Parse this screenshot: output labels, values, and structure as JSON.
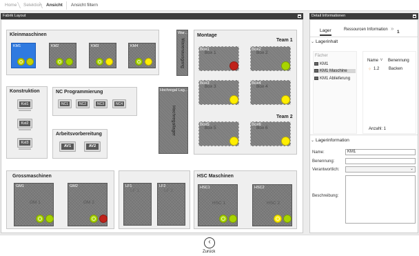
{
  "breadcrumb": {
    "home": "Home",
    "selection": "Selektion",
    "current": "Ansicht",
    "filter": "Ansicht filtern"
  },
  "layout_panel": {
    "title": "Fabrik Layout"
  },
  "kleinmaschinen": {
    "title": "Kleinmaschinen",
    "machines": [
      {
        "label": "KM1",
        "selected": true,
        "dots": [
          "#c8d400",
          "#c8d400"
        ]
      },
      {
        "label": "KM2",
        "dots": [
          "#a8d400",
          "#a8d400"
        ]
      },
      {
        "label": "KM3",
        "dots": [
          "#a8d400",
          "#ffee00"
        ]
      },
      {
        "label": "KM4",
        "dots": [
          "#a8d400",
          "#ffee00"
        ]
      }
    ]
  },
  "warenausgang": {
    "title": "War...",
    "text": "Warenausgang"
  },
  "hochregal": {
    "title": "Hochregal Lag...",
    "text": "Hochregallager"
  },
  "konstruktion": {
    "title": "Konstruktion",
    "pcs": [
      "Kst1",
      "Kst2",
      "Kst3"
    ]
  },
  "nc_programmierung": {
    "title": "NC Programmierung",
    "pcs": [
      "NC1",
      "NC2",
      "NC3",
      "NC4"
    ]
  },
  "arbeitsvorbereitung": {
    "title": "Arbeitsvorbereitung",
    "pcs": [
      "AV1",
      "AV2"
    ]
  },
  "montage": {
    "title": "Montage",
    "team1": "Team 1",
    "team2": "Team 2",
    "boxes": [
      {
        "label": "Box1",
        "ghost": "Box 1",
        "dot": "#c0221a"
      },
      {
        "label": "Box2",
        "ghost": "Box 2",
        "dot": "#a8d400"
      },
      {
        "label": "Box3",
        "ghost": "Box 3",
        "dot": "#ffee00"
      },
      {
        "label": "Box4",
        "ghost": "Box 4",
        "dot": "#ffee00"
      },
      {
        "label": "Box5",
        "ghost": "Box 5",
        "dot": "#ffee00"
      },
      {
        "label": "Box6",
        "ghost": "Box 6",
        "dot": "#ffee00"
      }
    ]
  },
  "grossmaschinen": {
    "title": "Grossmaschinen",
    "machines": [
      {
        "label": "GM1",
        "ghost": "GM 1",
        "dots": [
          "#a8d400",
          "#a8d400"
        ]
      },
      {
        "label": "GM2",
        "ghost": "GM 2",
        "dots": [
          "#a8d400",
          "#c0221a"
        ]
      }
    ]
  },
  "lf": {
    "items": [
      {
        "label": "LF1",
        "ghost": "LF 1"
      },
      {
        "label": "LF2",
        "ghost": "LF 2"
      }
    ]
  },
  "hsc": {
    "title": "HSC Maschinen",
    "machines": [
      {
        "label": "HSC1",
        "ghost": "HSC 1",
        "dots": [
          "#a8d400",
          "#a8d400"
        ]
      },
      {
        "label": "HSC2",
        "ghost": "HSC 2",
        "dots": [
          "#ffee00",
          "#a8d400"
        ]
      }
    ]
  },
  "detail_panel": {
    "title": "Detail Informationen",
    "tab_lager": "Lager",
    "tab_ressourcen": "Ressourcen Information",
    "tab_more": "»",
    "tab_count": "1",
    "lagerinhalt": "Lagerinhalt",
    "faecher_label": "Fächer",
    "tree": [
      "KM1",
      "KM1 Maschine",
      "KM1 Ablieferung"
    ],
    "col_name": "Name",
    "col_benennung": "Benennung",
    "row_name": "1.2",
    "row_benennung": "Backen",
    "anzahl": "Anzahl: 1",
    "lagerinformation": "Lagerinformation",
    "name_label": "Name:",
    "name_value": "KM1",
    "benennung_label": "Benennung:",
    "verantwortlich_label": "Verantwortlich:",
    "beschreibung_label": "Beschreibung:"
  },
  "footer": {
    "back_label": "Zurück"
  }
}
